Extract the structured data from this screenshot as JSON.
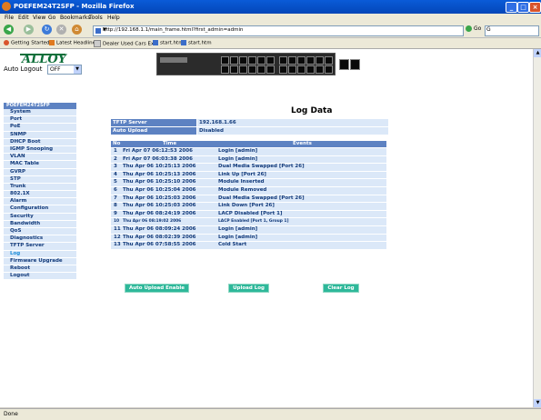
{
  "window": {
    "title": "POEFEM24T2SFP - Mozilla Firefox"
  },
  "menu": [
    "File",
    "Edit",
    "View",
    "Go",
    "Bookmarks",
    "Tools",
    "Help"
  ],
  "address_bar": {
    "url": "http://192.168.1.1/main_frame.html?first_admin=admin",
    "go_label": "Go"
  },
  "bookmarks": [
    {
      "label": "Getting Started",
      "icon": "firefox-icon"
    },
    {
      "label": "Latest Headlines",
      "icon": "rss-icon"
    },
    {
      "label": "Dealer Used Cars Ex...",
      "icon": "page-icon"
    },
    {
      "label": "start.htm",
      "icon": "page-icon"
    },
    {
      "label": "start.htm",
      "icon": "page-icon"
    }
  ],
  "header": {
    "logo": "ALLOY",
    "auto_logout_label": "Auto Logout",
    "auto_logout_value": "OFF"
  },
  "sidebar": {
    "device_name": "POEFEM24T2SFP",
    "items": [
      "System",
      "Port",
      "PoE",
      "SNMP",
      "DHCP Boot",
      "IGMP Snooping",
      "VLAN",
      "MAC Table",
      "GVRP",
      "STP",
      "Trunk",
      "802.1X",
      "Alarm",
      "Configuration",
      "Security",
      "Bandwidth",
      "QoS",
      "Diagnostics",
      "TFTP Server",
      "Log",
      "Firmware Upgrade",
      "Reboot",
      "Logout"
    ],
    "active_item": "Log"
  },
  "page": {
    "title": "Log Data",
    "tftp_server_label": "TFTP Server",
    "tftp_server_value": "192.168.1.66",
    "auto_upload_label": "Auto Upload",
    "auto_upload_value": "Disabled"
  },
  "log_table": {
    "headers": [
      "No",
      "Time",
      "Events"
    ],
    "rows": [
      [
        "1",
        "Fri Apr 07 06:12:53 2006",
        "Login [admin]"
      ],
      [
        "2",
        "Fri Apr 07 06:03:38 2006",
        "Login [admin]"
      ],
      [
        "3",
        "Thu Apr 06 10:25:13 2006",
        "Dual Media Swapped [Port 26]"
      ],
      [
        "4",
        "Thu Apr 06 10:25:13 2006",
        "Link Up [Port 26]"
      ],
      [
        "5",
        "Thu Apr 06 10:25:10 2006",
        "Module Inserted"
      ],
      [
        "6",
        "Thu Apr 06 10:25:04 2006",
        "Module Removed"
      ],
      [
        "7",
        "Thu Apr 06 10:25:03 2006",
        "Dual Media Swapped [Port 26]"
      ],
      [
        "8",
        "Thu Apr 06 10:25:03 2006",
        "Link Down [Port 26]"
      ],
      [
        "9",
        "Thu Apr 06 08:24:19 2006",
        "LACP Disabled [Port 1]"
      ],
      [
        "10",
        "Thu Apr 06 08:19:02 2006",
        "LACP Enabled [Port 1, Group 1]"
      ],
      [
        "11",
        "Thu Apr 06 08:09:24 2006",
        "Login [admin]"
      ],
      [
        "12",
        "Thu Apr 06 08:02:39 2006",
        "Login [admin]"
      ],
      [
        "13",
        "Thu Apr 06 07:58:55 2006",
        "Cold Start"
      ]
    ]
  },
  "buttons": {
    "auto_upload_enable": "Auto Upload Enable",
    "upload_log": "Upload Log",
    "clear_log": "Clear Log"
  },
  "status_bar": {
    "text": "Done"
  }
}
